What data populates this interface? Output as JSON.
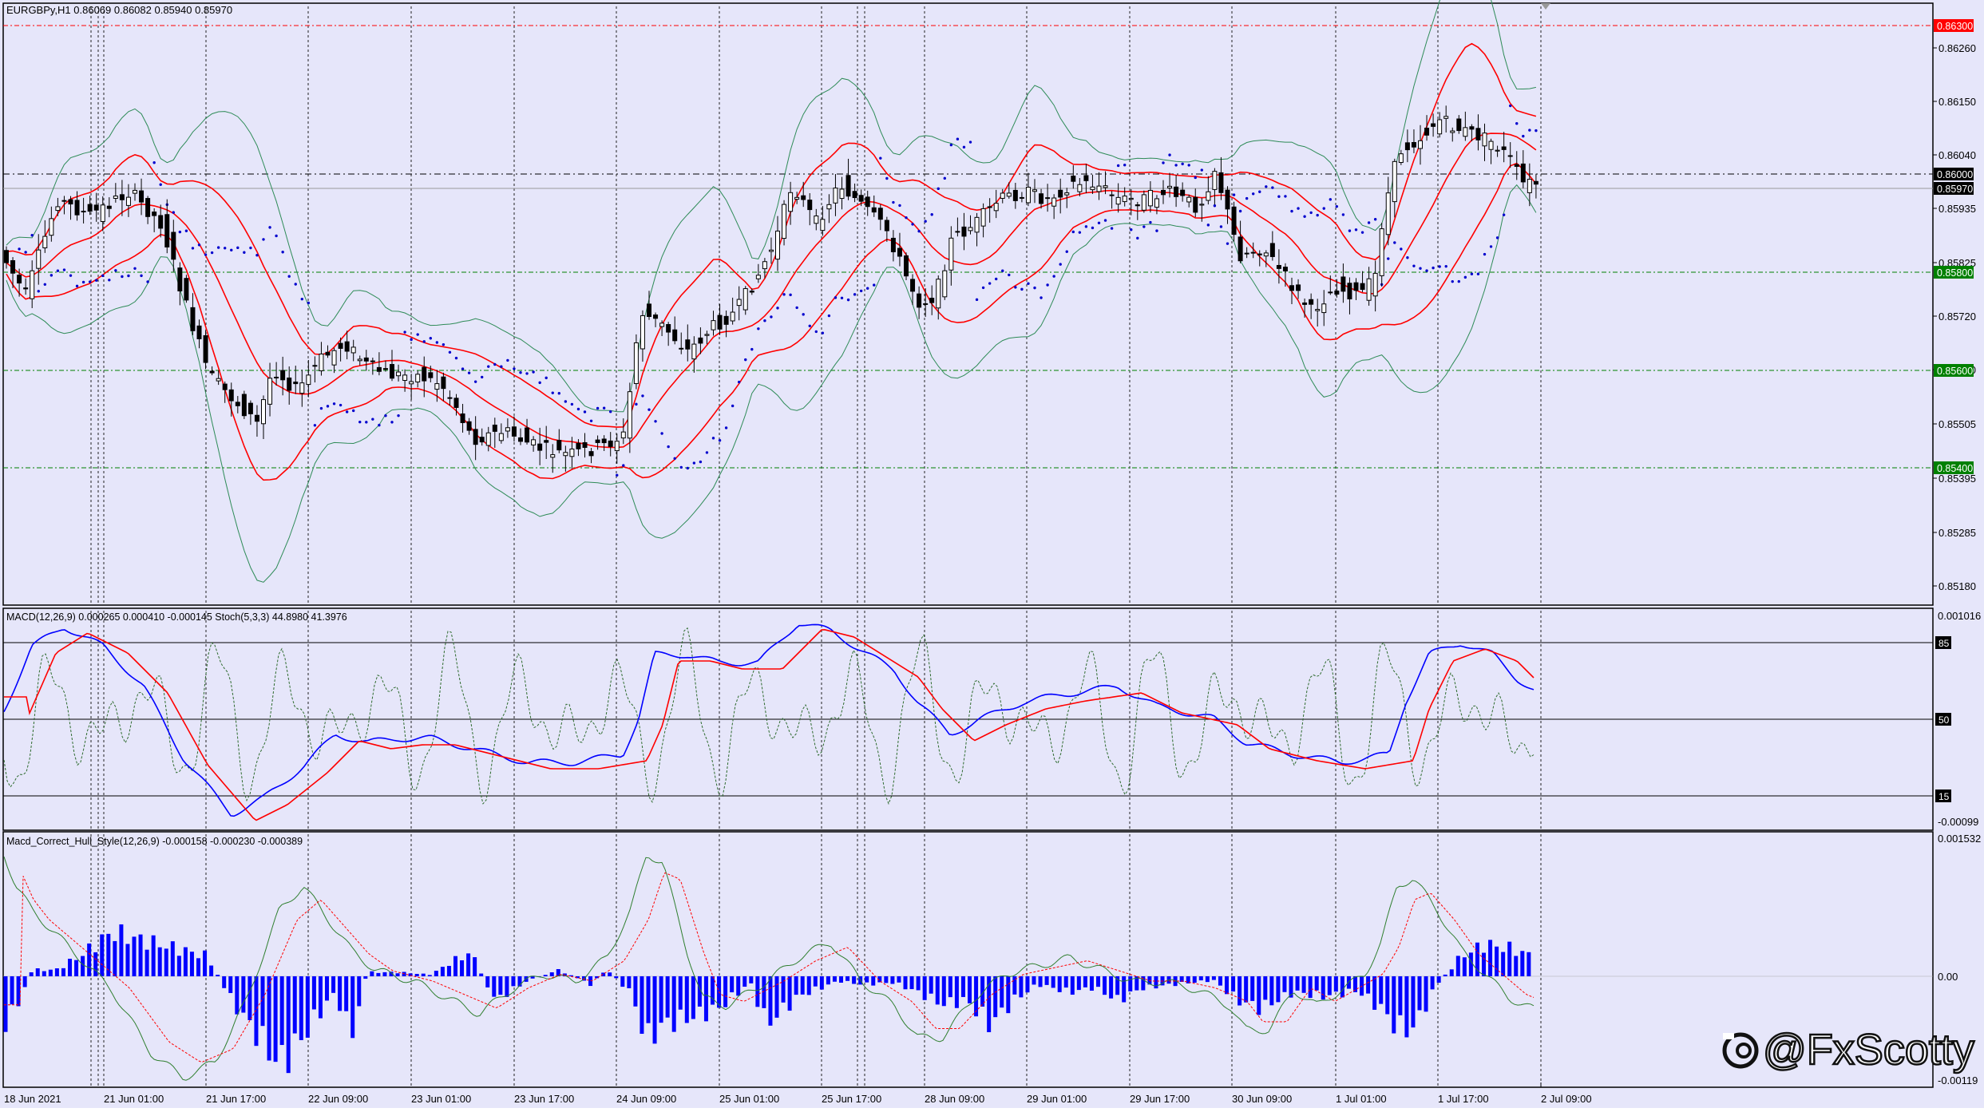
{
  "main": {
    "title": "EURGBPy,H1  0.86069 0.86082 0.85940 0.85970",
    "price_labels": [
      "0.86260",
      "0.86150",
      "0.86040",
      "0.85935",
      "0.85825",
      "0.85720",
      "0.85610",
      "0.85505",
      "0.85395",
      "0.85285",
      "0.85180"
    ],
    "levels": [
      {
        "label": "0.86300",
        "color": "#ff0000"
      },
      {
        "label": "0.86000",
        "color": "#000000"
      },
      {
        "label": "0.85970",
        "color": "#000000"
      },
      {
        "label": "0.85800",
        "color": "#008000"
      },
      {
        "label": "0.85600",
        "color": "#008000"
      },
      {
        "label": "0.85400",
        "color": "#008000"
      }
    ]
  },
  "indicator1": {
    "title": "MACD(12,26,9) 0.000265 0.000410 -0.000145  Stoch(5,3,3) 44.8980 41.3976",
    "scale_top": "0.001016",
    "scale_bottom": "-0.00099",
    "stoch_levels": [
      "85",
      "50",
      "15"
    ]
  },
  "indicator2": {
    "title": "Macd_Correct_Hull_Style(12,26,9) -0.000158 -0.000230 -0.000389",
    "scale_top": "0.001532",
    "scale_zero": "0.00",
    "scale_bottom": "-0.00119"
  },
  "time_labels": [
    "18 Jun 2021",
    "21 Jun 01:00",
    "21 Jun 17:00",
    "22 Jun 09:00",
    "23 Jun 01:00",
    "23 Jun 17:00",
    "24 Jun 09:00",
    "25 Jun 01:00",
    "25 Jun 17:00",
    "28 Jun 09:00",
    "29 Jun 01:00",
    "29 Jun 17:00",
    "30 Jun 09:00",
    "1 Jul 01:00",
    "1 Jul 17:00",
    "2 Jul 09:00"
  ],
  "watermark": "@FxScotty",
  "colors": {
    "background": "#e6e6fa",
    "bollinger": "#2e8b57",
    "envelope": "#ff0000",
    "sar": "#0000cd",
    "macd_main": "#0000ff",
    "macd_signal": "#ff0000",
    "stoch": "#2e6b2e",
    "histogram": "#0000ff"
  }
}
